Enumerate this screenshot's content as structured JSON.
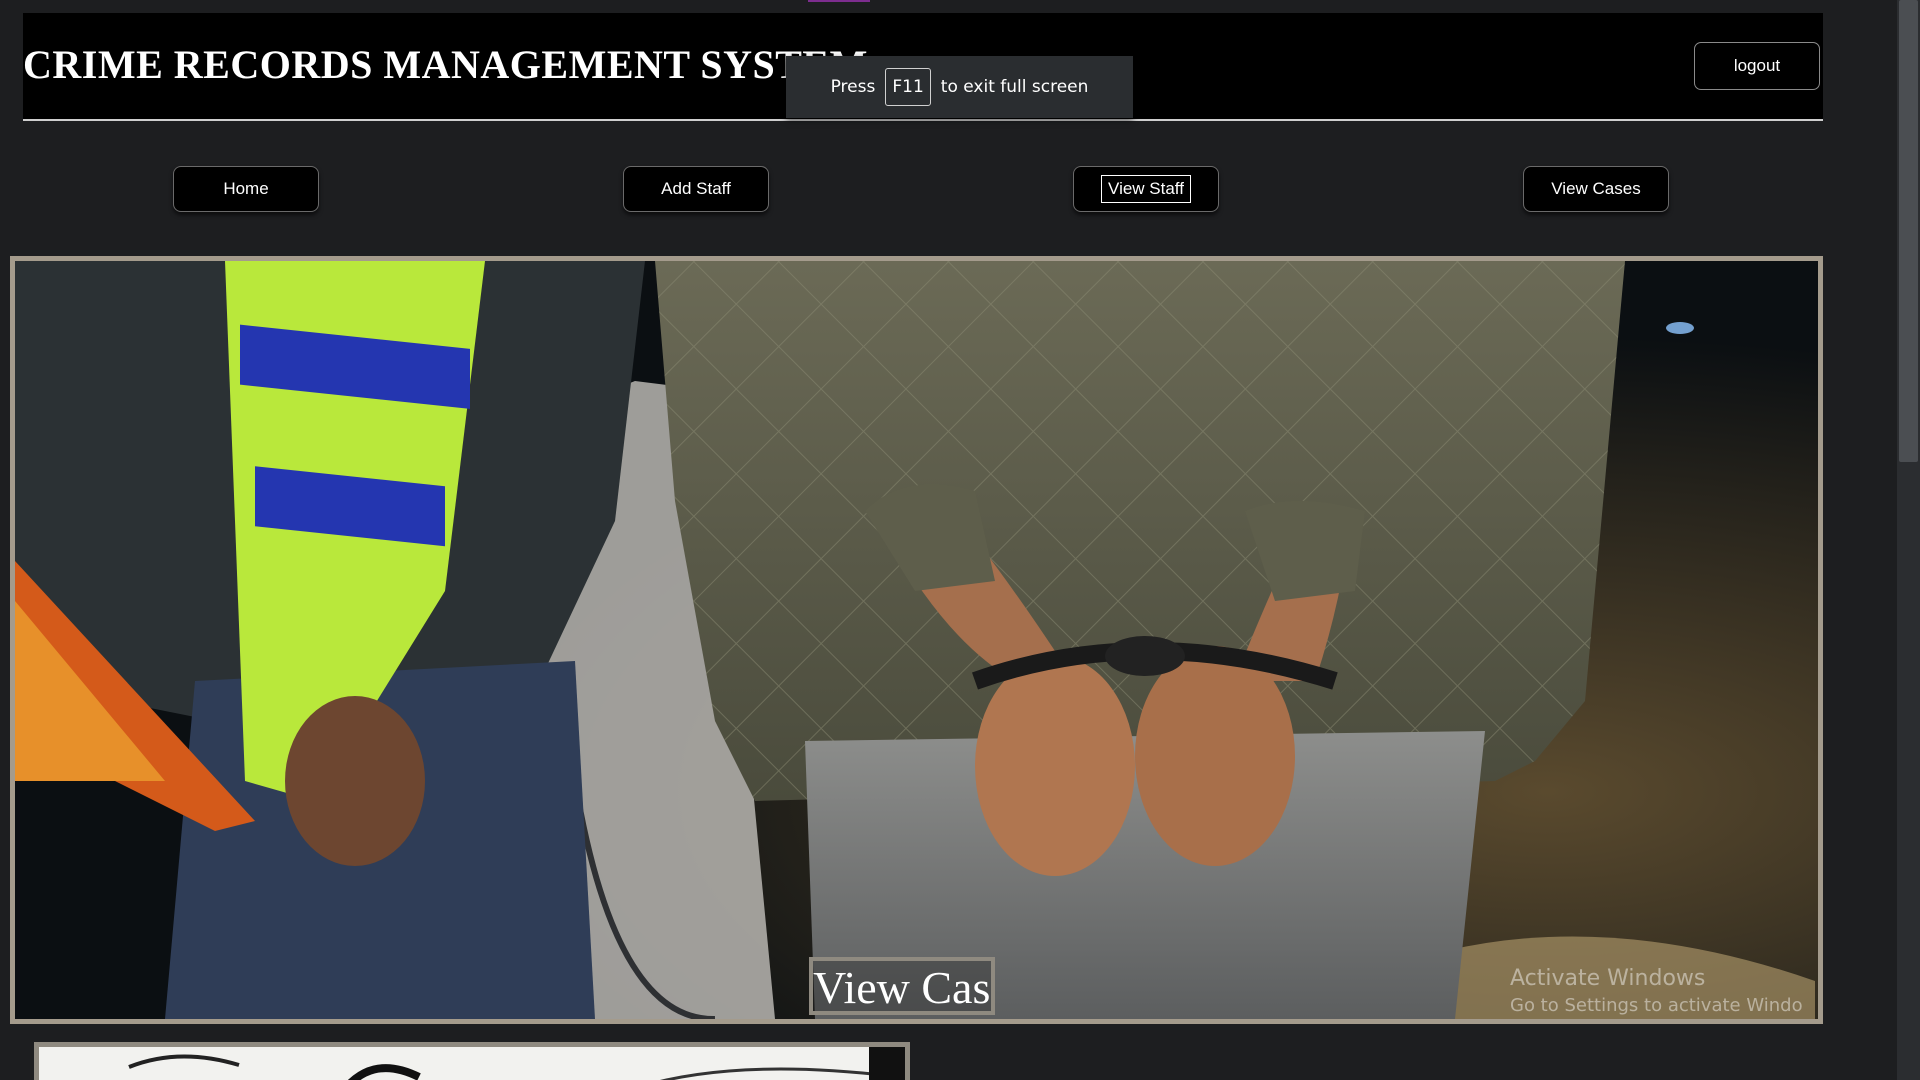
{
  "app": {
    "title": "CRIME RECORDS MANAGEMENT SYSTEM"
  },
  "header": {
    "logout_label": "logout"
  },
  "fullscreen_notice": {
    "prefix": "Press",
    "key": "F11",
    "suffix": "to exit full screen"
  },
  "nav": {
    "items": [
      {
        "label": "Home"
      },
      {
        "label": "Add Staff"
      },
      {
        "label": "View Staff"
      },
      {
        "label": "View Cases"
      }
    ]
  },
  "hero": {
    "caption": "View Cases",
    "image_subject": "handcuffed-person-photo"
  },
  "watermark": {
    "line1": "Activate Windows",
    "line2": "Go to Settings to activate Windo"
  },
  "colors": {
    "page_bg": "#1d1e20",
    "header_bg": "#000000",
    "card_border": "#a49b8c"
  }
}
